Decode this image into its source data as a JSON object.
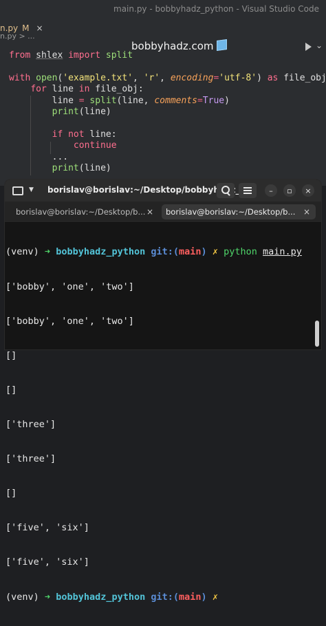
{
  "vscode": {
    "window_title": "main.py - bobbyhadz_python - Visual Studio Code",
    "tab": {
      "name": "n.py",
      "status": "M",
      "close": "×"
    },
    "brand": "bobbyhadz.com",
    "breadcrumb": "n.py > ...",
    "code_lines": [
      [
        "from",
        " ",
        "shlex",
        " ",
        "import",
        " split"
      ],
      [],
      [
        "with",
        " ",
        "open",
        "(",
        "'example.txt'",
        ", ",
        "'r'",
        ", ",
        "encoding",
        "=",
        "'utf-8'",
        ") ",
        "as",
        " file_obj:"
      ],
      [
        "    ",
        "for",
        " line ",
        "in",
        " file_obj:"
      ],
      [
        "        line ",
        "=",
        " ",
        "split",
        "(line, ",
        "comments",
        "=",
        "True",
        ")"
      ],
      [
        "        ",
        "print",
        "(line)"
      ],
      [],
      [
        "        ",
        "if",
        " ",
        "not",
        " line:"
      ],
      [
        "            ",
        "continue"
      ],
      [
        "        ",
        "..."
      ],
      [
        "        ",
        "print",
        "(line)"
      ]
    ]
  },
  "terminal": {
    "title": "borislav@borislav:~/Desktop/bobbyhadz_...",
    "tabs": [
      {
        "label": "borislav@borislav:~/Desktop/b...",
        "close": "×",
        "active": false
      },
      {
        "label": "borislav@borislav:~/Desktop/b...",
        "close": "×",
        "active": true
      }
    ],
    "prompt": {
      "venv": "(venv)",
      "arrow": "➜",
      "cwd": "bobbyhadz_python",
      "git_prefix": "git:(",
      "branch": "main",
      "git_suffix": ")",
      "dirty": "✗"
    },
    "command": {
      "program": "python",
      "arg": "main.py"
    },
    "output_lines": [
      "['bobby', 'one', 'two']",
      "['bobby', 'one', 'two']",
      "[]",
      "[]",
      "['three']",
      "['three']",
      "[]",
      "['five', 'six']",
      "['five', 'six']"
    ],
    "window_buttons": {
      "minimize": "–",
      "maximize": "▫",
      "close": "×"
    }
  }
}
